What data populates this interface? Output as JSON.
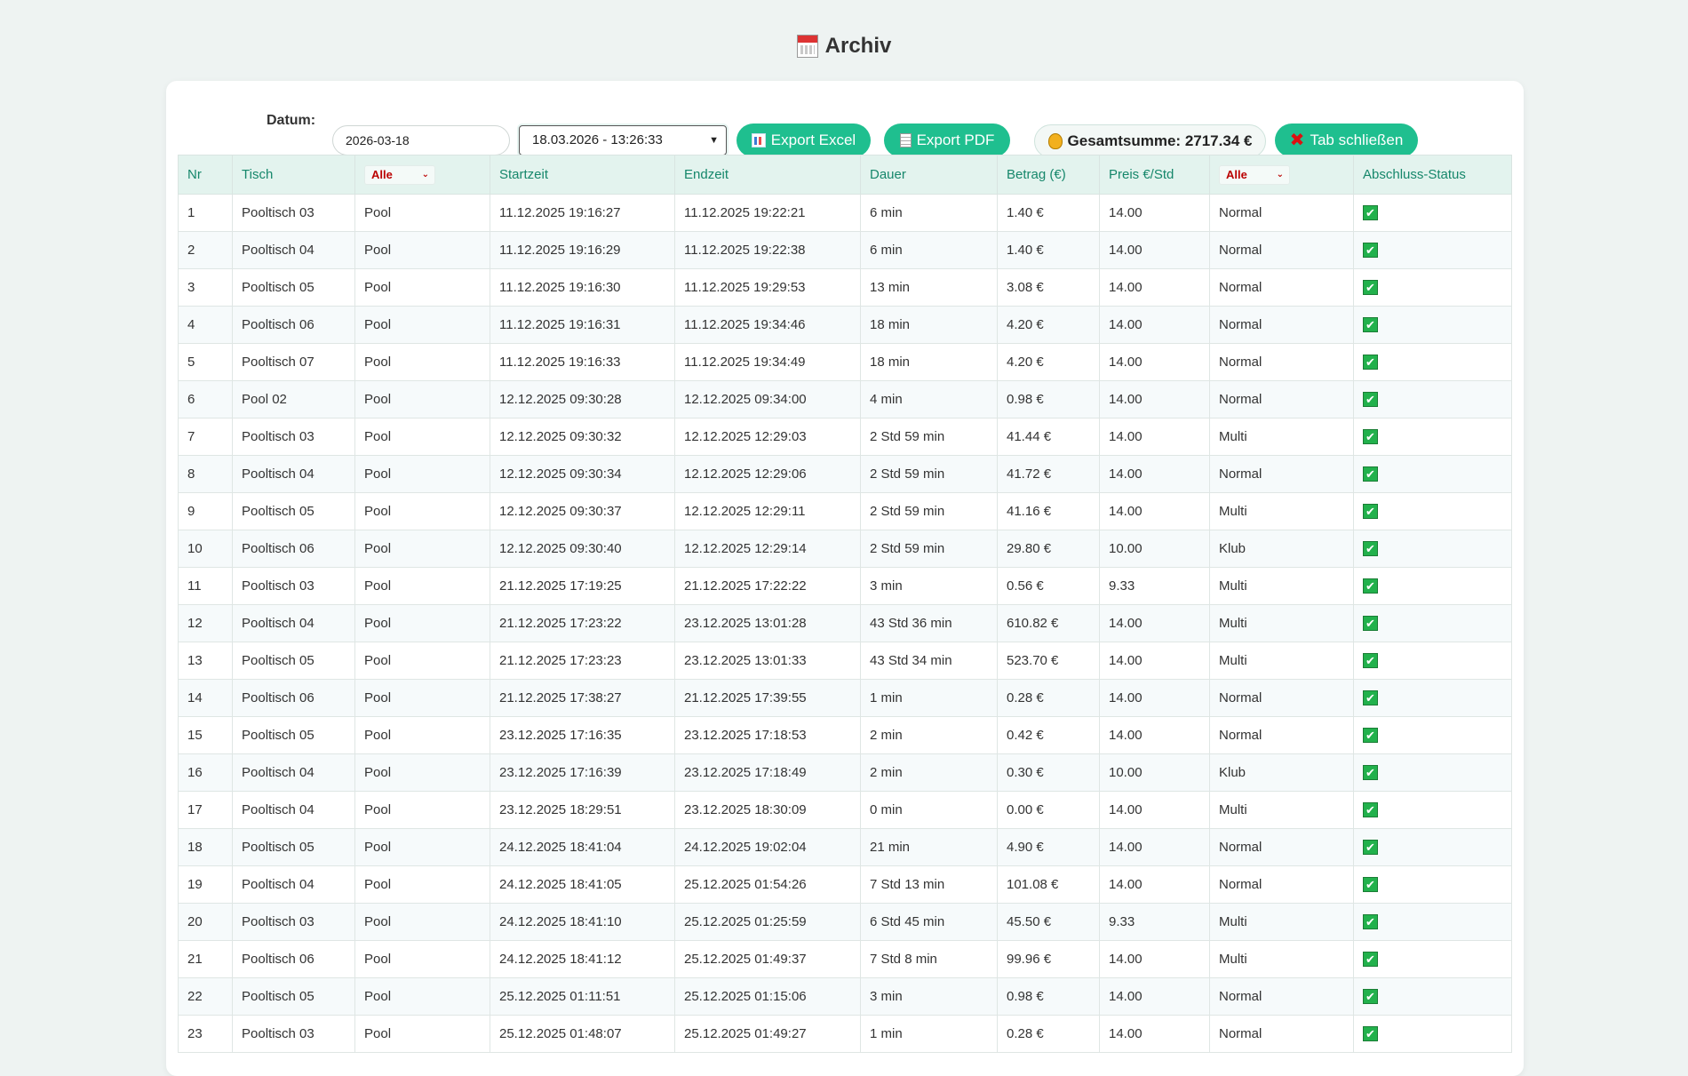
{
  "page": {
    "title": "Archiv"
  },
  "toolbar": {
    "date_label": "Datum:",
    "date_value": "2026-03-18",
    "session_selected": "18.03.2026 - 13:26:33",
    "export_excel": "Export Excel",
    "export_pdf": "Export PDF",
    "total": "Gesamtsumme: 2717.34 €",
    "close_tab": "Tab schließen"
  },
  "colors": {
    "accent": "#1fbf8f",
    "header_text": "#16876b",
    "filter_red": "#b00000",
    "check_green": "#22b14c"
  },
  "table": {
    "headers": [
      "Nr",
      "Tisch",
      "Startzeit",
      "Endzeit",
      "Dauer",
      "Betrag (€)",
      "Preis €/Std",
      "Abschluss-Status"
    ],
    "type_filter": "Alle",
    "mode_filter": "Alle",
    "rows": [
      [
        "1",
        "Pooltisch 03",
        "Pool",
        "11.12.2025 19:16:27",
        "11.12.2025 19:22:21",
        "6 min",
        "1.40 €",
        "14.00",
        "Normal"
      ],
      [
        "2",
        "Pooltisch 04",
        "Pool",
        "11.12.2025 19:16:29",
        "11.12.2025 19:22:38",
        "6 min",
        "1.40 €",
        "14.00",
        "Normal"
      ],
      [
        "3",
        "Pooltisch 05",
        "Pool",
        "11.12.2025 19:16:30",
        "11.12.2025 19:29:53",
        "13 min",
        "3.08 €",
        "14.00",
        "Normal"
      ],
      [
        "4",
        "Pooltisch 06",
        "Pool",
        "11.12.2025 19:16:31",
        "11.12.2025 19:34:46",
        "18 min",
        "4.20 €",
        "14.00",
        "Normal"
      ],
      [
        "5",
        "Pooltisch 07",
        "Pool",
        "11.12.2025 19:16:33",
        "11.12.2025 19:34:49",
        "18 min",
        "4.20 €",
        "14.00",
        "Normal"
      ],
      [
        "6",
        "Pool 02",
        "Pool",
        "12.12.2025 09:30:28",
        "12.12.2025 09:34:00",
        "4 min",
        "0.98 €",
        "14.00",
        "Normal"
      ],
      [
        "7",
        "Pooltisch 03",
        "Pool",
        "12.12.2025 09:30:32",
        "12.12.2025 12:29:03",
        "2 Std 59 min",
        "41.44 €",
        "14.00",
        "Multi"
      ],
      [
        "8",
        "Pooltisch 04",
        "Pool",
        "12.12.2025 09:30:34",
        "12.12.2025 12:29:06",
        "2 Std 59 min",
        "41.72 €",
        "14.00",
        "Normal"
      ],
      [
        "9",
        "Pooltisch 05",
        "Pool",
        "12.12.2025 09:30:37",
        "12.12.2025 12:29:11",
        "2 Std 59 min",
        "41.16 €",
        "14.00",
        "Multi"
      ],
      [
        "10",
        "Pooltisch 06",
        "Pool",
        "12.12.2025 09:30:40",
        "12.12.2025 12:29:14",
        "2 Std 59 min",
        "29.80 €",
        "10.00",
        "Klub"
      ],
      [
        "11",
        "Pooltisch 03",
        "Pool",
        "21.12.2025 17:19:25",
        "21.12.2025 17:22:22",
        "3 min",
        "0.56 €",
        "9.33",
        "Multi"
      ],
      [
        "12",
        "Pooltisch 04",
        "Pool",
        "21.12.2025 17:23:22",
        "23.12.2025 13:01:28",
        "43 Std 36 min",
        "610.82 €",
        "14.00",
        "Multi"
      ],
      [
        "13",
        "Pooltisch 05",
        "Pool",
        "21.12.2025 17:23:23",
        "23.12.2025 13:01:33",
        "43 Std 34 min",
        "523.70 €",
        "14.00",
        "Multi"
      ],
      [
        "14",
        "Pooltisch 06",
        "Pool",
        "21.12.2025 17:38:27",
        "21.12.2025 17:39:55",
        "1 min",
        "0.28 €",
        "14.00",
        "Normal"
      ],
      [
        "15",
        "Pooltisch 05",
        "Pool",
        "23.12.2025 17:16:35",
        "23.12.2025 17:18:53",
        "2 min",
        "0.42 €",
        "14.00",
        "Normal"
      ],
      [
        "16",
        "Pooltisch 04",
        "Pool",
        "23.12.2025 17:16:39",
        "23.12.2025 17:18:49",
        "2 min",
        "0.30 €",
        "10.00",
        "Klub"
      ],
      [
        "17",
        "Pooltisch 04",
        "Pool",
        "23.12.2025 18:29:51",
        "23.12.2025 18:30:09",
        "0 min",
        "0.00 €",
        "14.00",
        "Multi"
      ],
      [
        "18",
        "Pooltisch 05",
        "Pool",
        "24.12.2025 18:41:04",
        "24.12.2025 19:02:04",
        "21 min",
        "4.90 €",
        "14.00",
        "Normal"
      ],
      [
        "19",
        "Pooltisch 04",
        "Pool",
        "24.12.2025 18:41:05",
        "25.12.2025 01:54:26",
        "7 Std 13 min",
        "101.08 €",
        "14.00",
        "Normal"
      ],
      [
        "20",
        "Pooltisch 03",
        "Pool",
        "24.12.2025 18:41:10",
        "25.12.2025 01:25:59",
        "6 Std 45 min",
        "45.50 €",
        "9.33",
        "Multi"
      ],
      [
        "21",
        "Pooltisch 06",
        "Pool",
        "24.12.2025 18:41:12",
        "25.12.2025 01:49:37",
        "7 Std 8 min",
        "99.96 €",
        "14.00",
        "Multi"
      ],
      [
        "22",
        "Pooltisch 05",
        "Pool",
        "25.12.2025 01:11:51",
        "25.12.2025 01:15:06",
        "3 min",
        "0.98 €",
        "14.00",
        "Normal"
      ],
      [
        "23",
        "Pooltisch 03",
        "Pool",
        "25.12.2025 01:48:07",
        "25.12.2025 01:49:27",
        "1 min",
        "0.28 €",
        "14.00",
        "Normal"
      ]
    ]
  }
}
